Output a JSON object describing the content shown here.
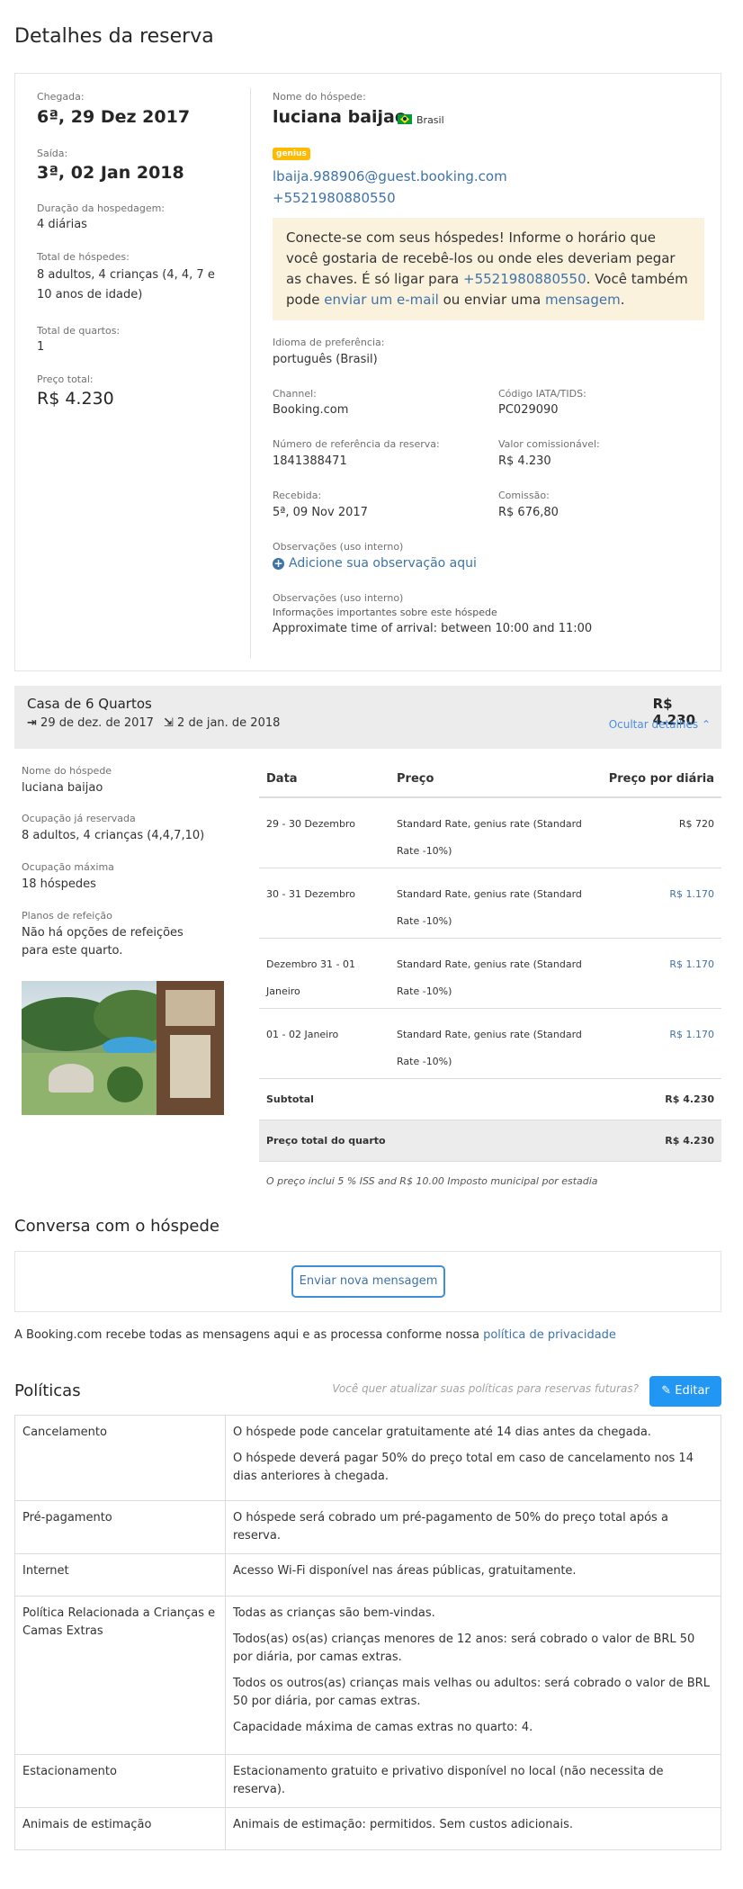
{
  "title": "Detalhes da reserva",
  "summary": {
    "checkin_label": "Chegada:",
    "checkin": "6ª, 29 Dez 2017",
    "checkout_label": "Saída:",
    "checkout": "3ª, 02 Jan 2018",
    "duration_label": "Duração da hospedagem:",
    "duration": "4 diárias",
    "guests_label": "Total de hóspedes:",
    "guests": "8 adultos, 4 crianças (4, 4, 7 e 10 anos de idade)",
    "rooms_label": "Total de quartos:",
    "rooms": "1",
    "price_label": "Preço total:",
    "price": "R$ 4.230"
  },
  "guest": {
    "name_label": "Nome do hóspede:",
    "name": "luciana baijao",
    "country": "Brasil",
    "badge": "genius",
    "email": "lbaija.988906@guest.booking.com",
    "phone": "+5521980880550"
  },
  "notice": {
    "t1": "Conecte-se com seus hóspedes! Informe o horário que você gostaria de recebê-los ou onde eles deveriam pegar as chaves. É só ligar para ",
    "phone": "+5521980880550",
    "t2": ". Você também pode ",
    "email_link": "enviar um e-mail",
    "t3": " ou enviar uma ",
    "msg_link": "mensagem",
    "t4": "."
  },
  "info": {
    "lang_label": "Idioma de preferência:",
    "lang": "português (Brasil)",
    "channel_label": "Channel:",
    "channel": "Booking.com",
    "iata_label": "Código IATA/TIDS:",
    "iata": "PC029090",
    "ref_label": "Número de referência da reserva:",
    "ref": "1841388471",
    "commissionable_label": "Valor comissionável:",
    "commissionable": "R$ 4.230",
    "received_label": "Recebida:",
    "received": "5ª, 09 Nov 2017",
    "commission_label": "Comissão:",
    "commission": "R$ 676,80",
    "notes_label": "Observações (uso interno)",
    "add_note": "Adicione sua observação aqui",
    "notes2_label": "Observações (uso interno)",
    "notes2_sub": "Informações importantes sobre este hóspede",
    "notes2_text": "Approximate time of arrival: between 10:00 and 11:00"
  },
  "room": {
    "name": "Casa de 6 Quartos",
    "price": "R$ 4.230",
    "checkin": "29 de dez. de 2017",
    "checkout": "2 de jan. de 2018",
    "hide": "Ocultar detalhes",
    "guest_label": "Nome do hóspede",
    "guest": "luciana baijao",
    "occ_label": "Ocupação já reservada",
    "occ": "8 adultos, 4 crianças (4,4,7,10)",
    "max_label": "Ocupação máxima",
    "max": "18 hóspedes",
    "meal_label": "Planos de refeição",
    "meal": "Não há opções de refeições para este quarto."
  },
  "rates": {
    "headers": [
      "Data",
      "Preço",
      "Preço por diária"
    ],
    "rows": [
      {
        "date": "29 - 30 Dezembro",
        "rate": "Standard Rate, genius rate (Standard Rate -10%)",
        "price": "R$ 720"
      },
      {
        "date": "30 - 31 Dezembro",
        "rate": "Standard Rate, genius rate (Standard Rate -10%)",
        "price": "R$ 1.170"
      },
      {
        "date": "Dezembro 31 - 01 Janeiro",
        "rate": "Standard Rate, genius rate (Standard Rate -10%)",
        "price": "R$ 1.170"
      },
      {
        "date": "01 - 02 Janeiro",
        "rate": "Standard Rate, genius rate (Standard Rate -10%)",
        "price": "R$ 1.170"
      }
    ],
    "subtotal_label": "Subtotal",
    "subtotal": "R$ 4.230",
    "total_label": "Preço total do quarto",
    "total": "R$ 4.230",
    "tax_note": "O preço inclui 5 % ISS and R$ 10.00 Imposto municipal por estadia"
  },
  "conversation": {
    "title": "Conversa com o hóspede",
    "button": "Enviar nova mensagem",
    "privacy_text": "A Booking.com recebe todas as mensagens aqui e as processa conforme nossa ",
    "privacy_link": "política de privacidade"
  },
  "policies": {
    "title": "Políticas",
    "hint": "Você quer atualizar suas políticas para reservas futuras?",
    "edit": "Editar",
    "rows": [
      {
        "label": "Cancelamento",
        "texts": [
          "O hóspede pode cancelar gratuitamente até 14 dias antes da chegada.",
          "O hóspede deverá pagar 50% do preço total em caso de cancelamento nos 14 dias anteriores à chegada."
        ]
      },
      {
        "label": "Pré-pagamento",
        "texts": [
          "O hóspede será cobrado um pré-pagamento de 50% do preço total após a reserva."
        ]
      },
      {
        "label": "Internet",
        "texts": [
          "Acesso Wi-Fi disponível nas áreas públicas, gratuitamente."
        ]
      },
      {
        "label": "Política Relacionada a Crianças e Camas Extras",
        "texts": [
          "Todas as crianças são bem-vindas.",
          "Todos(as) os(as) crianças menores de 12 anos: será cobrado o valor de BRL 50 por diária, por camas extras.",
          "Todos os outros(as) crianças mais velhas ou adultos: será cobrado o valor de BRL 50 por diária, por camas extras.",
          "Capacidade máxima de camas extras no quarto: 4."
        ]
      },
      {
        "label": "Estacionamento",
        "texts": [
          "Estacionamento gratuito e privativo disponível no local (não necessita de reserva)."
        ]
      },
      {
        "label": "Animais de estimação",
        "texts": [
          "Animais de estimação: permitidos. Sem custos adicionais."
        ]
      }
    ]
  },
  "colors": {
    "link": "#3e73a8",
    "notice_bg": "#fbf2de",
    "genius": "#febb02",
    "button": "#2196f3",
    "room_bar": "#ececec"
  }
}
